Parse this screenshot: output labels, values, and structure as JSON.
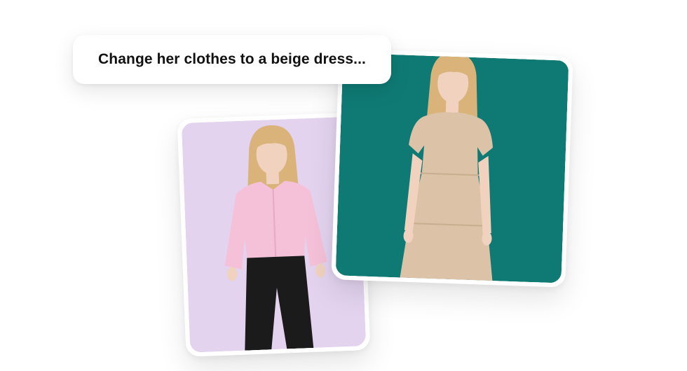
{
  "prompt": {
    "text": "Change her clothes to a beige dress..."
  },
  "before_image": {
    "background_color": "#e3d3ef",
    "top_color": "#f4c1d9",
    "bottom_color": "#1b1b1b"
  },
  "after_image": {
    "background_color": "#0f7a74",
    "dress_color": "#dcc3a7"
  },
  "colors": {
    "hair": "#d9b37a",
    "skin": "#f0d2bf"
  }
}
